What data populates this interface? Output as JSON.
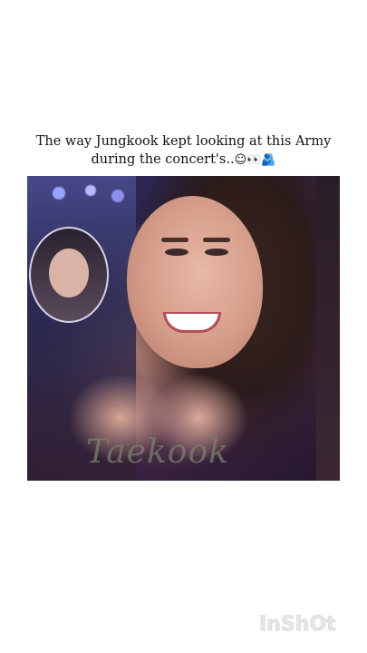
{
  "caption": {
    "line1": "The way Jungkook kept looking at this Army",
    "line2_text": "during the concert's..",
    "line2_emojis": "☺👀🫂"
  },
  "video": {
    "watermark": "Taekook"
  },
  "app_watermark": "InShOt"
}
